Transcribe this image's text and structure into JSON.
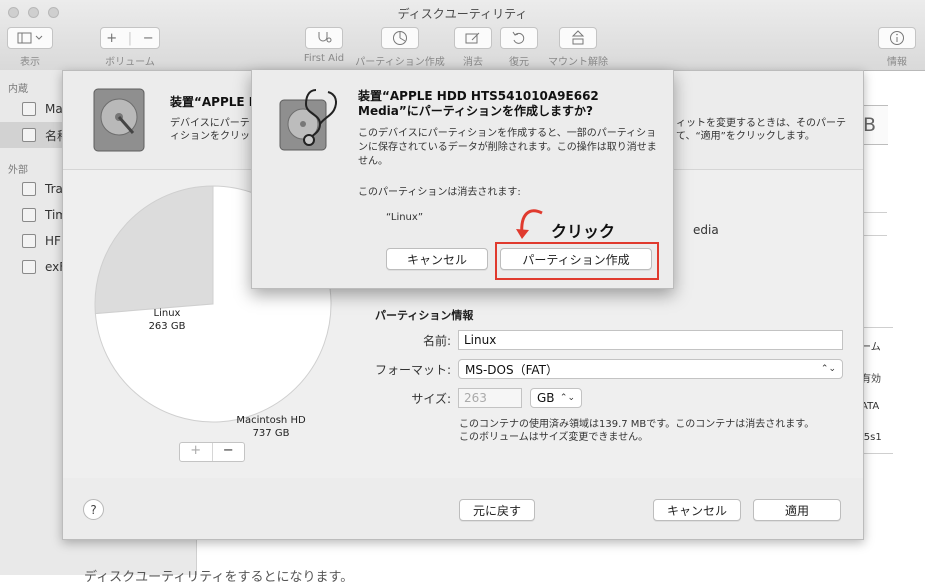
{
  "window": {
    "title": "ディスクユーティリティ",
    "toolbar": {
      "view_label": "表示",
      "volume_label": "ボリューム",
      "first_aid_label": "First Aid",
      "partition_label": "パーティション作成",
      "erase_label": "消去",
      "restore_label": "復元",
      "unmount_label": "マウント解除",
      "info_label": "情報"
    }
  },
  "sidebar": {
    "internal_header": "内蔵",
    "external_header": "外部",
    "internal_items": [
      "Ma",
      "名称"
    ],
    "external_items": [
      "Tra",
      "Tim",
      "HF",
      "exF"
    ]
  },
  "background": {
    "size_partial": "B",
    "media_partial": "edia",
    "info_partial": [
      "ーム",
      "有効",
      "ATA",
      "i5s1"
    ],
    "caption_partial": "ディスクユーティリティをするとになります。"
  },
  "sheet": {
    "title": "装置“APPLE H",
    "desc_lines": [
      "デバイスにパーテ",
      "ィションをクリッ"
    ],
    "desc_right_lines": [
      "ィットを変更するときは、そのパーテ",
      "て、“適用”をクリックします。"
    ],
    "pie": {
      "slices": [
        {
          "name": "Linux",
          "size": "263 GB",
          "fraction": 0.263,
          "color": "#dcdcdc"
        },
        {
          "name": "Macintosh HD",
          "size": "737 GB",
          "fraction": 0.737,
          "color": "#ffffff"
        }
      ]
    },
    "partition_info_title": "パーティション情報",
    "name_label": "名前:",
    "name_value": "Linux",
    "format_label": "フォーマット:",
    "format_value": "MS-DOS（FAT）",
    "size_label": "サイズ:",
    "size_value": "263",
    "size_unit": "GB",
    "note_lines": [
      "このコンテナの使用済み領域は139.7 MBです。このコンテナは消去されます。",
      "このボリュームはサイズ変更できません。"
    ],
    "plus": "+",
    "minus": "−",
    "help": "?",
    "revert_label": "元に戻す",
    "cancel_label": "キャンセル",
    "apply_label": "適用"
  },
  "alert": {
    "title": "装置“APPLE HDD HTS541010A9E662 Media”にパーティションを作成しますか?",
    "message": "このデバイスにパーティションを作成すると、一部のパーティションに保存されているデータが削除されます。この操作は取り消せません。",
    "erase_note": "このパーティションは消去されます:",
    "volume": "“Linux”",
    "cancel_label": "キャンセル",
    "confirm_label": "パーティション作成"
  },
  "annotation": {
    "text": "クリック",
    "color": "#e03a2e"
  }
}
